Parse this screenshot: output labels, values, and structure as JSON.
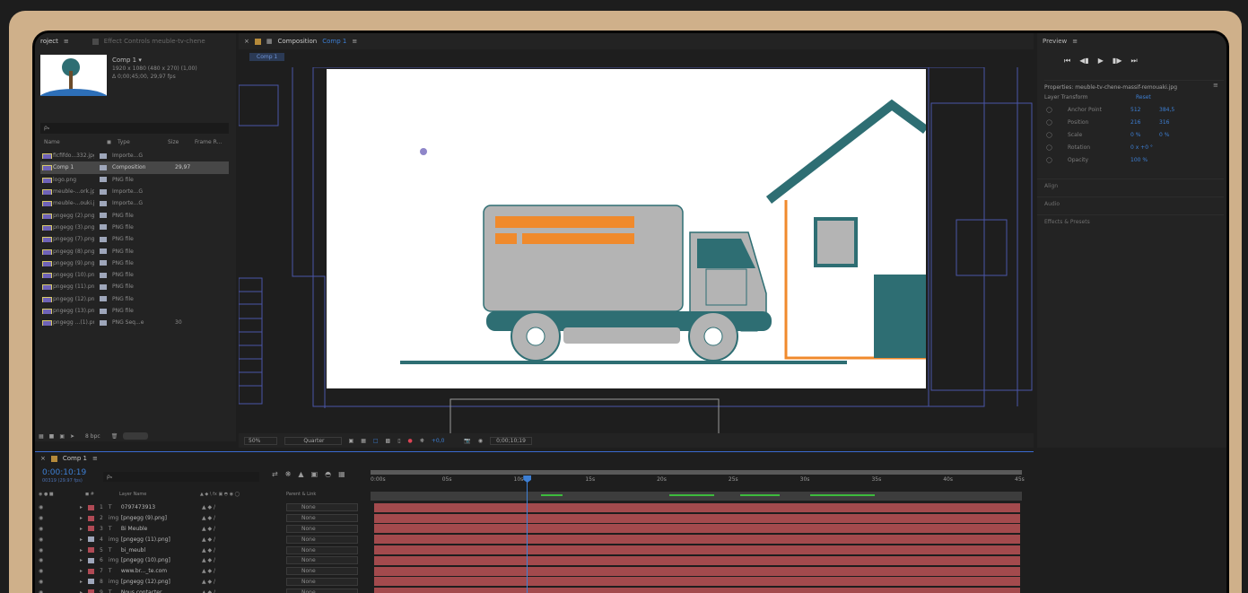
{
  "project": {
    "tab_project": "roject",
    "tab_effects": "Effect Controls meuble-tv-chene",
    "comp_name": "Comp 1 ▾",
    "comp_info1": "1920 x 1080  (480 x 270) (1,00)",
    "comp_info2": "Δ 0;00;45;00, 29,97 fps",
    "search_placeholder": "ρₐ",
    "columns": {
      "name": "Name",
      "type": "Type",
      "size": "Size",
      "frame": "Frame R..."
    },
    "items": [
      {
        "name": "ficfifdo...332.jpg",
        "type": "Importe...G",
        "frame": ""
      },
      {
        "name": "Comp 1",
        "type": "Composition",
        "frame": "29,97"
      },
      {
        "name": "logo.png",
        "type": "PNG file",
        "frame": ""
      },
      {
        "name": "meuble-...ork.jpg",
        "type": "Importe...G",
        "frame": ""
      },
      {
        "name": "meuble-...ouki.jpg",
        "type": "Importe...G",
        "frame": ""
      },
      {
        "name": "pngegg (2).png",
        "type": "PNG file",
        "frame": ""
      },
      {
        "name": "pngegg (3).png",
        "type": "PNG file",
        "frame": ""
      },
      {
        "name": "pngegg (7).png",
        "type": "PNG file",
        "frame": ""
      },
      {
        "name": "pngegg (8).png",
        "type": "PNG file",
        "frame": ""
      },
      {
        "name": "pngegg (9).png",
        "type": "PNG file",
        "frame": ""
      },
      {
        "name": "pngegg (10).png",
        "type": "PNG file",
        "frame": ""
      },
      {
        "name": "pngegg (11).png",
        "type": "PNG file",
        "frame": ""
      },
      {
        "name": "pngegg (12).png",
        "type": "PNG file",
        "frame": ""
      },
      {
        "name": "pngegg (13).png",
        "type": "PNG file",
        "frame": ""
      },
      {
        "name": "pngegg ...(1).png",
        "type": "PNG Seq...e",
        "frame": "30"
      }
    ],
    "bpc": "8 bpc"
  },
  "composition": {
    "tab_title": "Composition",
    "tab_comp": "Comp 1",
    "subtab": "Comp 1",
    "zoom": "50%",
    "quality": "Quarter",
    "exposure": "+0,0",
    "timecode": "0;00;10;19"
  },
  "preview": {
    "title": "Preview"
  },
  "properties": {
    "title": "Properties: meuble-tv-chene-massif-remouaki.jpg",
    "layer_transform": "Layer Transform",
    "reset": "Reset",
    "rows": [
      {
        "label": "Anchor Point",
        "v1": "512",
        "v2": "384,5"
      },
      {
        "label": "Position",
        "v1": "216",
        "v2": "316"
      },
      {
        "label": "Scale",
        "v1": "0 %",
        "v2": "0 %"
      },
      {
        "label": "Rotation",
        "v1": "0 x +0 °",
        "v2": ""
      },
      {
        "label": "Opacity",
        "v1": "100 %",
        "v2": ""
      }
    ],
    "sections": [
      "Align",
      "Audio",
      "Effects & Presets"
    ]
  },
  "timeline": {
    "tab": "Comp 1",
    "timecode": "0:00:10:19",
    "fps": "00319 (29.97 fps)",
    "search": "ρₐ",
    "col_layer": "Layer Name",
    "col_parent": "Parent & Link",
    "ruler": [
      "0:00s",
      "05s",
      "10s",
      "15s",
      "20s",
      "25s",
      "30s",
      "35s",
      "40s",
      "45s"
    ],
    "playhead_fraction": 0.24,
    "layers": [
      {
        "num": "1",
        "kind": "T",
        "name": "0797473913",
        "color": "#b04a55",
        "parent": "None"
      },
      {
        "num": "2",
        "kind": "img",
        "name": "[pngegg (9).png]",
        "color": "#b04a55",
        "parent": "None"
      },
      {
        "num": "3",
        "kind": "T",
        "name": "Bi Meuble",
        "color": "#b04a55",
        "parent": "None"
      },
      {
        "num": "4",
        "kind": "img",
        "name": "[pngegg (11).png]",
        "color": "#9ea6ba",
        "parent": "None"
      },
      {
        "num": "5",
        "kind": "T",
        "name": "bi_meubl",
        "color": "#b04a55",
        "parent": "None"
      },
      {
        "num": "6",
        "kind": "img",
        "name": "[pngegg (10).png]",
        "color": "#9ea6ba",
        "parent": "None"
      },
      {
        "num": "7",
        "kind": "T",
        "name": "www.br..._te.com",
        "color": "#b04a55",
        "parent": "None"
      },
      {
        "num": "8",
        "kind": "img",
        "name": "[pngegg (12).png]",
        "color": "#9ea6ba",
        "parent": "None"
      },
      {
        "num": "9",
        "kind": "T",
        "name": "Nous contacter",
        "color": "#b04a55",
        "parent": "None"
      }
    ]
  },
  "colors": {
    "accent": "#3d7fd4",
    "teal": "#2e6e73",
    "orange": "#f08a2c",
    "truck_gray": "#b4b4b4",
    "layer_bar": "#a34a4d"
  }
}
